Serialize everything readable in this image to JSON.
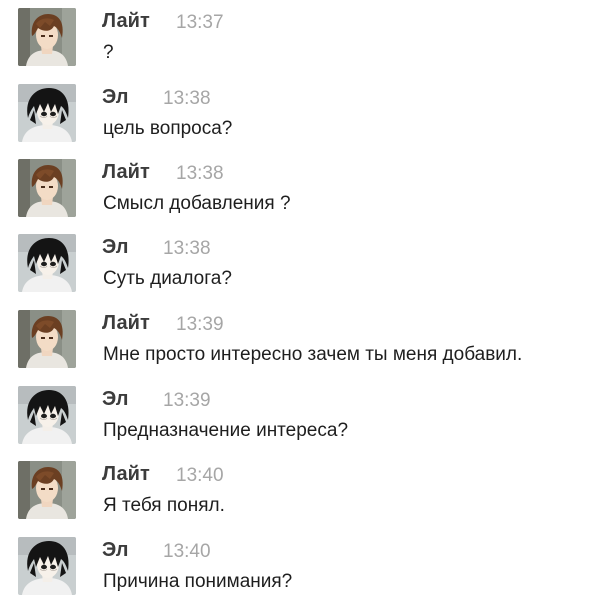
{
  "messages": [
    {
      "author": "Лайт",
      "time": "13:37",
      "text": "?",
      "avatar": "light-avatar-icon"
    },
    {
      "author": "Эл",
      "time": "13:38",
      "text": "цель вопроса?",
      "avatar": "l-avatar-icon"
    },
    {
      "author": "Лайт",
      "time": "13:38",
      "text": "Смысл добавления ?",
      "avatar": "light-avatar-icon"
    },
    {
      "author": "Эл",
      "time": "13:38",
      "text": "Суть диалога?",
      "avatar": "l-avatar-icon"
    },
    {
      "author": "Лайт",
      "time": "13:39",
      "text": "Мне просто интересно зачем ты меня добавил.",
      "avatar": "light-avatar-icon"
    },
    {
      "author": "Эл",
      "time": "13:39",
      "text": "Предназначение интереса?",
      "avatar": "l-avatar-icon"
    },
    {
      "author": "Лайт",
      "time": "13:40",
      "text": "Я тебя понял.",
      "avatar": "light-avatar-icon"
    },
    {
      "author": "Эл",
      "time": "13:40",
      "text": "Причина понимания?",
      "avatar": "l-avatar-icon"
    }
  ],
  "colors": {
    "author": "#3c3c3c",
    "time": "#a6a6a6",
    "text": "#1e1e1e",
    "background": "#ffffff"
  }
}
